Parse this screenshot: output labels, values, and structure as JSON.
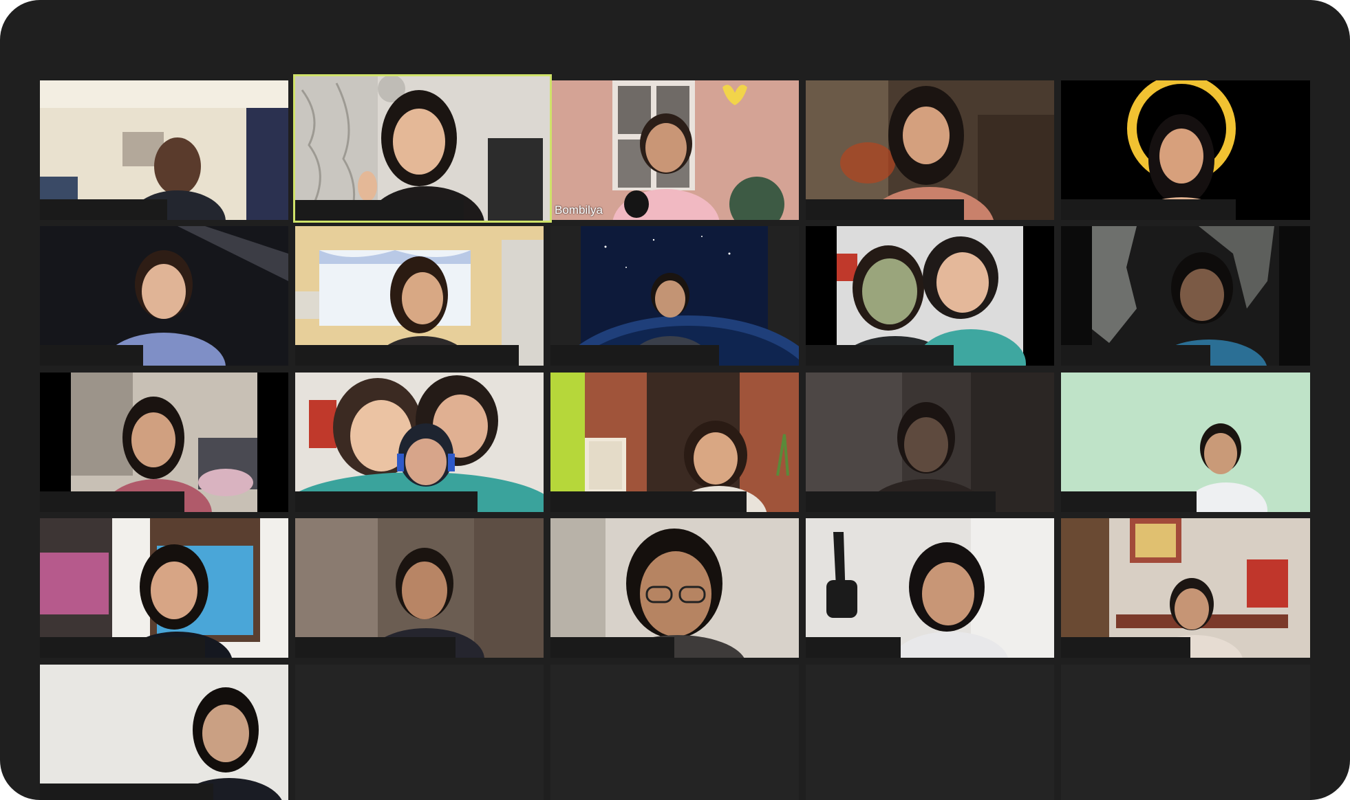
{
  "meeting": {
    "view": "gallery",
    "columns": 5,
    "rows": 5,
    "accent_colors": {
      "active_speaker_border": "#cfe26a",
      "window_background": "#1f1f1f",
      "empty_tile": "#242424"
    },
    "participants": [
      {
        "name": "",
        "active_speaker": false
      },
      {
        "name": "",
        "active_speaker": true
      },
      {
        "name": "Bombilya",
        "active_speaker": false
      },
      {
        "name": "",
        "active_speaker": false
      },
      {
        "name": "",
        "active_speaker": false
      },
      {
        "name": "",
        "active_speaker": false
      },
      {
        "name": "",
        "active_speaker": false
      },
      {
        "name": "",
        "active_speaker": false
      },
      {
        "name": "",
        "active_speaker": false
      },
      {
        "name": "",
        "active_speaker": false
      },
      {
        "name": "",
        "active_speaker": false
      },
      {
        "name": "",
        "active_speaker": false
      },
      {
        "name": "",
        "active_speaker": false
      },
      {
        "name": "",
        "active_speaker": false
      },
      {
        "name": "",
        "active_speaker": false
      },
      {
        "name": "",
        "active_speaker": false
      },
      {
        "name": "",
        "active_speaker": false
      },
      {
        "name": "",
        "active_speaker": false
      },
      {
        "name": "",
        "active_speaker": false
      },
      {
        "name": "",
        "active_speaker": false
      },
      {
        "name": "",
        "active_speaker": false
      }
    ]
  }
}
